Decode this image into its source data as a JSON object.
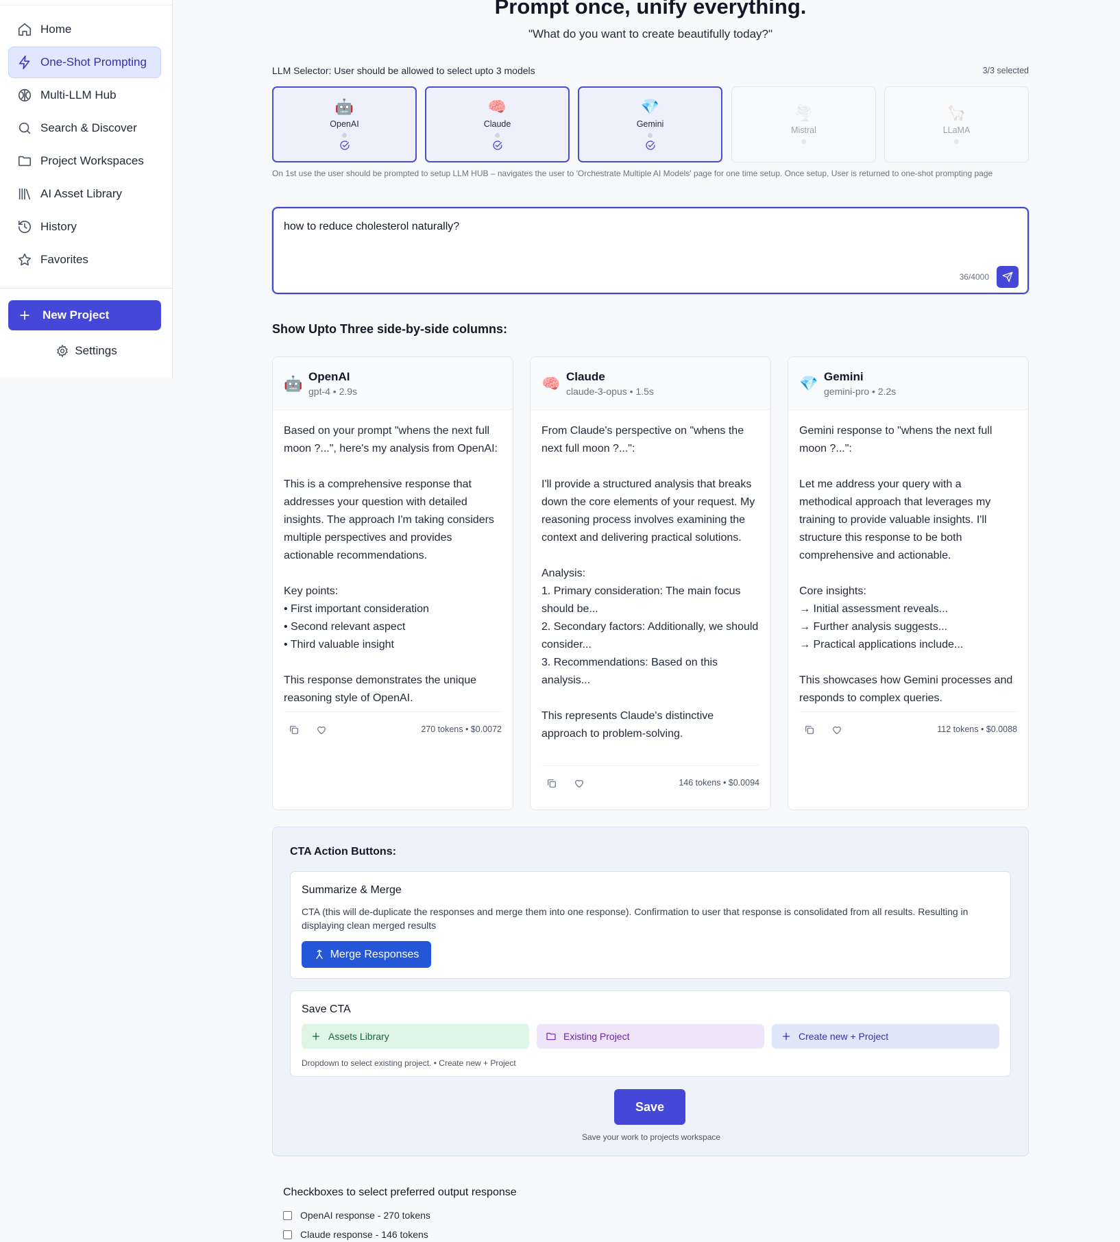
{
  "sidebar": {
    "items": [
      {
        "label": "Home",
        "icon": "home-icon"
      },
      {
        "label": "One-Shot Prompting",
        "icon": "lightning-icon",
        "active": true
      },
      {
        "label": "Multi-LLM Hub",
        "icon": "brain-icon"
      },
      {
        "label": "Search & Discover",
        "icon": "search-icon"
      },
      {
        "label": "Project Workspaces",
        "icon": "folder-icon"
      },
      {
        "label": "AI Asset Library",
        "icon": "library-icon"
      },
      {
        "label": "History",
        "icon": "history-icon"
      },
      {
        "label": "Favorites",
        "icon": "star-icon"
      }
    ],
    "new_project": "New Project",
    "settings": "Settings"
  },
  "header": {
    "title": "Prompt once, unify everything.",
    "subtitle": "\"What do you want to create beautifully today?\""
  },
  "selector": {
    "label": "LLM Selector: User should be allowed to select upto 3 models",
    "count": "3/3 selected",
    "models": [
      {
        "name": "OpenAI",
        "emoji": "🤖",
        "selected": true
      },
      {
        "name": "Claude",
        "emoji": "🧠",
        "selected": true
      },
      {
        "name": "Gemini",
        "emoji": "💎",
        "selected": true
      },
      {
        "name": "Mistral",
        "emoji": "🌪️",
        "selected": false
      },
      {
        "name": "LLaMA",
        "emoji": "🦙",
        "selected": false
      }
    ],
    "note": "On 1st use the user should be prompted to setup LLM HUB – navigates the user to 'Orchestrate Multiple AI Models' page for one time setup. Once setup, User is returned to one-shot prompting page"
  },
  "prompt": {
    "value": "how to reduce cholesterol naturally?",
    "count": "36/4000"
  },
  "columns": {
    "heading": "Show Upto Three side-by-side columns:",
    "responses": [
      {
        "name": "OpenAI",
        "emoji": "🤖",
        "meta": "gpt-4 • 2.9s",
        "body": "Based on your prompt \"whens the next full moon ?...\", here's my analysis from OpenAI:\n\nThis is a comprehensive response that addresses your question with detailed insights. The approach I'm taking considers multiple perspectives and provides actionable recommendations.\n\nKey points:\n• First important consideration\n• Second relevant aspect\n• Third valuable insight\n\nThis response demonstrates the unique reasoning style of OpenAI.",
        "stats": "270 tokens • $0.0072"
      },
      {
        "name": "Claude",
        "emoji": "🧠",
        "meta": "claude-3-opus • 1.5s",
        "body": "From Claude's perspective on \"whens the next full moon ?...\":\n\nI'll provide a structured analysis that breaks down the core elements of your request. My reasoning process involves examining the context and delivering practical solutions.\n\nAnalysis:\n1. Primary consideration: The main focus should be...\n2. Secondary factors: Additionally, we should consider...\n3. Recommendations: Based on this analysis...\n\nThis represents Claude's distinctive approach to problem-solving.",
        "stats": "146 tokens • $0.0094"
      },
      {
        "name": "Gemini",
        "emoji": "💎",
        "meta": "gemini-pro • 2.2s",
        "body": "Gemini response to \"whens the next full moon ?...\":\n\nLet me address your query with a methodical approach that leverages my training to provide valuable insights. I'll structure this response to be both comprehensive and actionable.\n\nCore insights:\n→ Initial assessment reveals...\n→ Further analysis suggests...\n→ Practical applications include...\n\nThis showcases how Gemini processes and responds to complex queries.",
        "stats": "112 tokens • $0.0088"
      }
    ]
  },
  "cta": {
    "heading": "CTA Action Buttons:",
    "merge": {
      "title": "Summarize & Merge",
      "description": "CTA (this will de-duplicate the responses and merge them into one response). Confirmation to user that response is consolidated from all results. Resulting in displaying clean merged results",
      "button": "Merge Responses"
    },
    "save": {
      "title": "Save CTA",
      "options": [
        "Assets Library",
        "Existing Project",
        "Create new + Project"
      ],
      "hint": "Dropdown to select existing project. • Create new + Project",
      "button": "Save",
      "subtext": "Save your work to projects workspace"
    }
  },
  "checkboxes": {
    "heading": "Checkboxes to select preferred output response",
    "items": [
      "OpenAI response - 270 tokens",
      "Claude response - 146 tokens"
    ]
  },
  "colors": {
    "accent": "#4547d9",
    "merge_button": "#2456d8",
    "active_nav_bg": "#e0e7ff"
  }
}
